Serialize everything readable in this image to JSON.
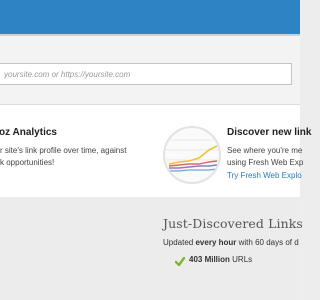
{
  "search": {
    "placeholder": "yoursite.com or https://yoursite.com"
  },
  "features": {
    "analytics": {
      "title": "oz Analytics",
      "lines": [
        "r site's link profile over time, against",
        "k opportunities!"
      ]
    },
    "discover": {
      "title": "Discover new link",
      "lines": [
        "See where you're me",
        "using Fresh Web Exp"
      ],
      "link": "Try Fresh Web Explo"
    }
  },
  "just_discovered": {
    "title": "Just-Discovered Links",
    "subtitle_prefix": "Updated",
    "subtitle_bold": "every hour",
    "subtitle_suffix": "with 60 days of d",
    "stat_bold": "403 Million",
    "stat_suffix": "URLs"
  },
  "colors": {
    "header": "#2e83c4",
    "link": "#2b79c2",
    "check": "#7fb52f"
  },
  "icons": [
    "chart-thumbnail-icon",
    "checkmark-icon"
  ]
}
